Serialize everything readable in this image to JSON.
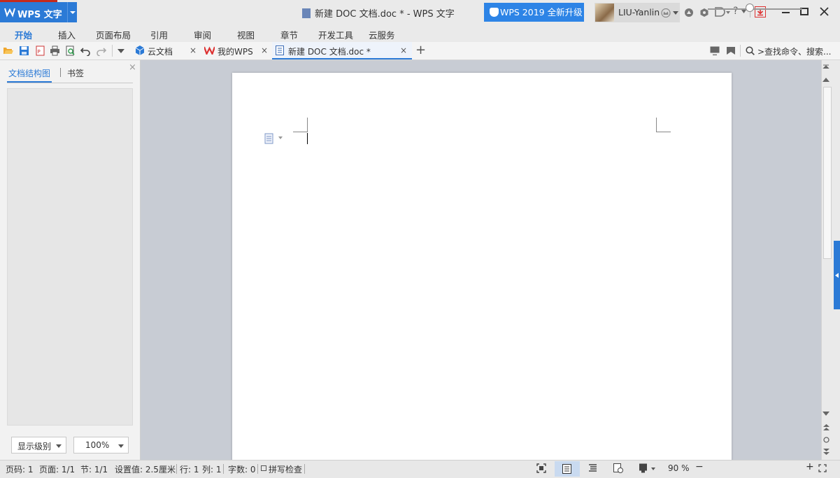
{
  "app": {
    "name": "WPS 文字",
    "window_title": "新建 DOC 文档.doc * - WPS 文字",
    "upgrade_label": "WPS 2019 全新升级",
    "username": "LIU-Yanlin",
    "accent": "#2b7ad6"
  },
  "menu": [
    "开始",
    "插入",
    "页面布局",
    "引用",
    "审阅",
    "视图",
    "章节",
    "开发工具",
    "云服务"
  ],
  "tabs": [
    {
      "label": "云文档",
      "icon": "cloud-doc-icon",
      "close": "×"
    },
    {
      "label": "我的WPS",
      "icon": "wps-logo-icon",
      "close": "×"
    },
    {
      "label": "新建 DOC 文档.doc *",
      "icon": "doc-file-icon",
      "close": "×",
      "active": true
    }
  ],
  "new_tab": "+",
  "search": {
    "placeholder": ">查找命令、搜索..."
  },
  "nav_panel": {
    "tab_outline": "文档结构图",
    "tab_bookmark": "书签",
    "close": "×",
    "level_select": "显示级别",
    "zoom_select": "100%"
  },
  "status": {
    "page_num": "页码: 1",
    "pages": "页面: 1/1",
    "section": "节: 1/1",
    "setting": "设置值: 2.5厘米",
    "row": "行: 1",
    "col": "列: 1",
    "word_count": "字数: 0",
    "spell_check": "拼写检查",
    "zoom": "90 %",
    "zoom_minus": "−",
    "zoom_plus": "+"
  }
}
